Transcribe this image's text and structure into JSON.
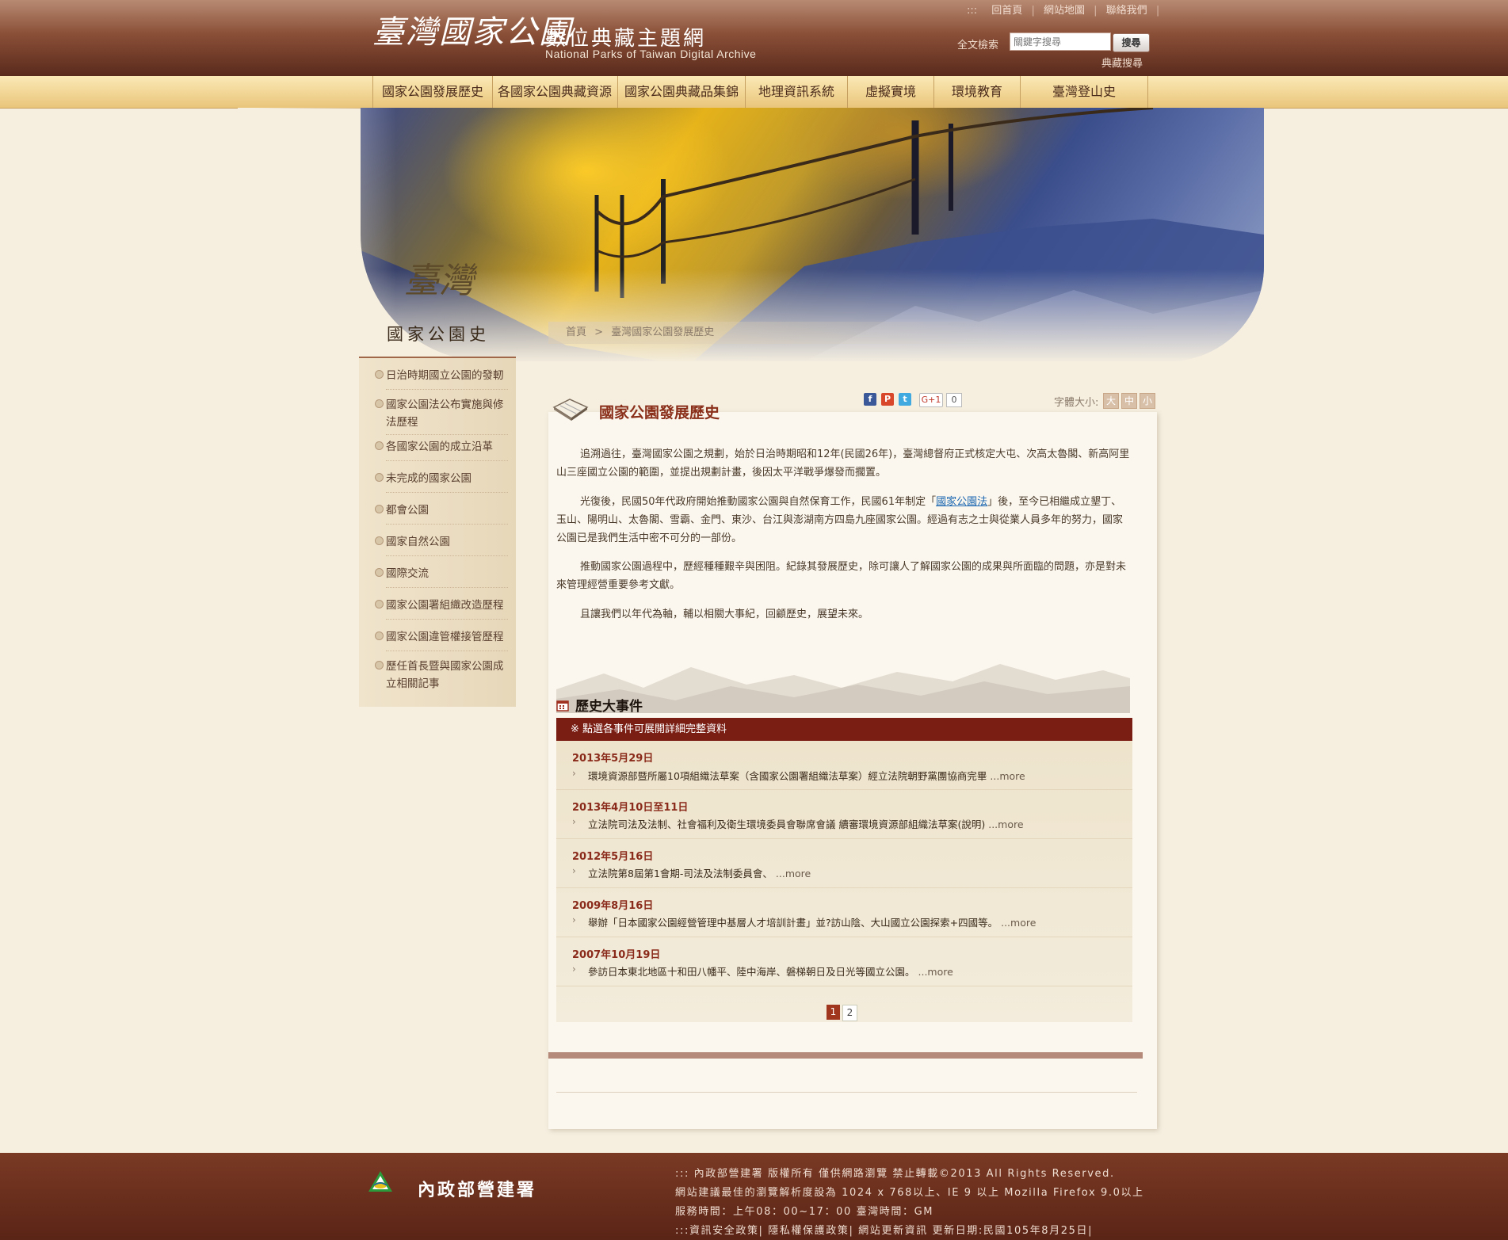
{
  "header": {
    "logo_main": "臺灣國家公園",
    "logo_sub": "數位典藏主題網",
    "logo_en": "National Parks of Taiwan Digital Archive",
    "top_links": [
      ":::",
      "回首頁",
      "網站地圖",
      "聯絡我們"
    ],
    "search_label": "全文檢索",
    "search_placeholder": "關鍵字搜尋",
    "search_button": "搜尋",
    "collection_search": "典藏搜尋"
  },
  "nav": {
    "items": [
      "國家公園發展歷史",
      "各國家公園典藏資源",
      "國家公園典藏品集錦",
      "地理資訊系統",
      "虛擬實境",
      "環境教育",
      "臺灣登山史"
    ]
  },
  "side": {
    "logo_glyph": "臺灣",
    "title": "國家公園史",
    "items": [
      "日治時期國立公園的發軔",
      "國家公園法公布實施與修法歷程",
      "各國家公園的成立沿革",
      "未完成的國家公園",
      "都會公園",
      "國家自然公園",
      "國際交流",
      "國家公園署組織改造歷程",
      "國家公園違管權接管歷程",
      "歷任首長暨與國家公園成立相關記事"
    ]
  },
  "breadcrumb": {
    "home": "首頁",
    "sep": ">",
    "current": "臺灣國家公園發展歷史"
  },
  "main": {
    "title": "國家公園發展歷史",
    "share": {
      "gplus": "G+1",
      "count": "0"
    },
    "font_size": {
      "label": "字體大小:",
      "large": "大",
      "medium": "中",
      "small": "小"
    },
    "paragraphs": [
      "追溯過往，臺灣國家公園之規劃，始於日治時期昭和12年(民國26年)，臺灣總督府正式核定大屯、次高太魯閣、新高阿里山三座國立公園的範圍，並提出規劃計畫，後因太平洋戰爭爆發而擱置。",
      "光復後，民國50年代政府開始推動國家公園與自然保育工作，民國61年制定「",
      "國家公園法",
      "」後，至今已相繼成立墾丁、玉山、陽明山、太魯閣、雪霸、金門、東沙、台江與澎湖南方四島九座國家公園。經過有志之士與從業人員多年的努力，國家公園已是我們生活中密不可分的一部份。",
      "推動國家公園過程中，歷經種種艱辛與困阻。紀錄其發展歷史，除可讓人了解國家公園的成果與所面臨的問題，亦是對未來管理經營重要參考文獻。",
      "且讓我們以年代為軸，輔以相關大事紀，回顧歷史，展望未來。"
    ],
    "events_title": "歷史大事件",
    "events_hint": "※ 點選各事件可展開詳細完整資料",
    "events": [
      {
        "date": "2013年5月29日",
        "text": "環境資源部暨所屬10項組織法草案（含國家公園署組織法草案）經立法院朝野黨團協商完畢",
        "more": "...more"
      },
      {
        "date": "2013年4月10日至11日",
        "text": "立法院司法及法制、社會福利及衛生環境委員會聯席會議 續審環境資源部組織法草案(說明)",
        "more": "...more"
      },
      {
        "date": "2012年5月16日",
        "text": "立法院第8屆第1會期-司法及法制委員會、",
        "more": "...more"
      },
      {
        "date": "2009年8月16日",
        "text": "舉辦「日本國家公園經營管理中基層人才培訓計畫」並?訪山陰、大山國立公園探索+四國等。",
        "more": "...more"
      },
      {
        "date": "2007年10月19日",
        "text": "參訪日本東北地區十和田八幡平、陸中海岸、磐梯朝日及日光等國立公園。",
        "more": "...more"
      }
    ],
    "pages": [
      "1",
      "2"
    ]
  },
  "footer": {
    "org": "內政部營建署",
    "lines": [
      "::: 內政部營建署 版權所有 僅供網路瀏覽 禁止轉載©2013 All Rights Reserved.",
      "網站建議最佳的瀏覽解析度設為 1024 x 768以上、IE 9 以上 Mozilla Firefox 9.0以上",
      "服務時間：上午08：00~17：00 臺灣時間：GM",
      ":::資訊安全政策| 隱私權保護政策| 網站更新資訊 更新日期:民國105年8月25日|"
    ]
  },
  "colors": {
    "header_brown": "#8a4f37",
    "nav_gold": "#e9c57a",
    "accent_red": "#8a2f1a",
    "event_bar": "#7a1e14",
    "link_blue": "#1a66b0"
  }
}
